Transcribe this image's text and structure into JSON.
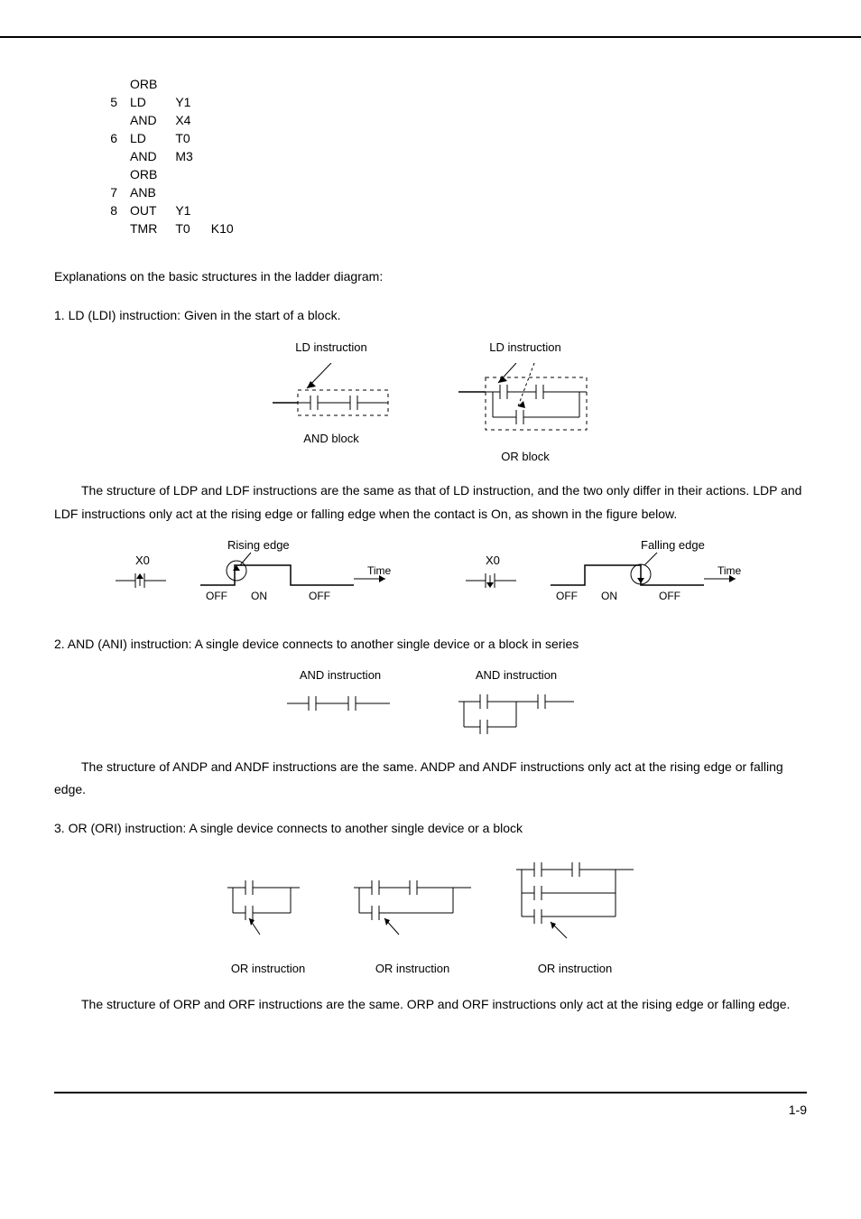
{
  "code_rows": [
    {
      "n": "",
      "op": "ORB",
      "a": "",
      "b": ""
    },
    {
      "n": "5",
      "op": "LD",
      "a": "Y1",
      "b": ""
    },
    {
      "n": "",
      "op": "AND",
      "a": "X4",
      "b": ""
    },
    {
      "n": "6",
      "op": "LD",
      "a": "T0",
      "b": ""
    },
    {
      "n": "",
      "op": "AND",
      "a": "M3",
      "b": ""
    },
    {
      "n": "",
      "op": "ORB",
      "a": "",
      "b": ""
    },
    {
      "n": "7",
      "op": "ANB",
      "a": "",
      "b": ""
    },
    {
      "n": "8",
      "op": "OUT",
      "a": "Y1",
      "b": ""
    },
    {
      "n": "",
      "op": "TMR",
      "a": "T0",
      "b": "K10"
    }
  ],
  "text": {
    "intro": "Explanations on the basic structures in the ladder diagram:",
    "s1_title": "1. LD (LDI) instruction: Given in the start of a block.",
    "fig1": {
      "lbl_ld": "LD instruction",
      "lbl_and_block": "AND block",
      "lbl_or_block": "OR block"
    },
    "s1_body": "The structure of LDP and LDF instructions are the same as that of LD instruction, and the two only differ in their actions. LDP and LDF instructions only act at the rising edge or falling edge when the contact is On, as shown in the figure below.",
    "fig2": {
      "rising": "Rising edge",
      "falling": "Falling edge",
      "x0": "X0",
      "time": "Time",
      "on": "ON",
      "off": "OFF"
    },
    "s2_title": "2. AND (ANI) instruction: A single device connects to another single device or a block in series",
    "fig3": {
      "lbl_and": "AND instruction"
    },
    "s2_body": "The structure of ANDP and ANDF instructions are the same. ANDP and ANDF instructions only act at the rising edge or falling edge.",
    "s3_title": "3. OR (ORI) instruction: A single device connects to another single device or a block",
    "fig4": {
      "lbl_or": "OR instruction"
    },
    "s3_body": "The structure of ORP and ORF instructions are the same. ORP and ORF instructions only act at the rising edge or falling edge.",
    "page_no": "1-9"
  }
}
